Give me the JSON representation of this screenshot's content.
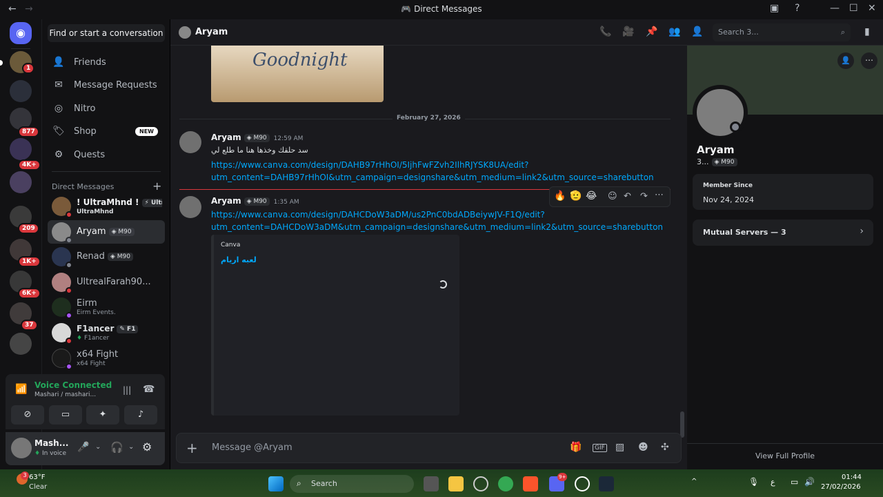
{
  "window": {
    "title": "Direct Messages"
  },
  "guilds": {
    "badges": [
      "1",
      "877",
      "4K+",
      "209",
      "1K+",
      "6K+",
      "37"
    ]
  },
  "dm_sidebar": {
    "find_label": "Find or start a conversation",
    "nav": [
      {
        "label": "Friends",
        "icon": "friends-icon"
      },
      {
        "label": "Message Requests",
        "icon": "envelope-icon"
      },
      {
        "label": "Nitro",
        "icon": "nitro-icon"
      },
      {
        "label": "Shop",
        "icon": "shop-icon",
        "badge": "NEW"
      },
      {
        "label": "Quests",
        "icon": "quests-icon"
      }
    ],
    "section_title": "Direct Messages",
    "dms": [
      {
        "name": "! UltraMhnd !",
        "tag": "Ultr",
        "sub": "UltraMhnd"
      },
      {
        "name": "Aryam",
        "tag": "M90",
        "sub": ""
      },
      {
        "name": "Renad",
        "tag": "M90",
        "sub": ""
      },
      {
        "name": "UltrealFarah90...",
        "tag": "",
        "sub": ""
      },
      {
        "name": "Eirm",
        "tag": "",
        "sub": "Eirm Events."
      },
      {
        "name": "F1ancer",
        "tag": "F1",
        "sub": "F1ancer"
      },
      {
        "name": "x64 Fight",
        "tag": "",
        "sub": "x64 Fight"
      }
    ]
  },
  "voice": {
    "title": "Voice Connected",
    "sub": "Mashari / mashari..."
  },
  "user": {
    "name": "Mash...",
    "status": "In voice"
  },
  "chat": {
    "name": "Aryam",
    "search_placeholder": "Search 3...",
    "date_divider": "February 27, 2026",
    "image_text": "Goodnight",
    "messages": [
      {
        "author": "Aryam",
        "tag": "M90",
        "time": "12:59 AM",
        "text": "سد حلقك وخذها هنا ما طلع لي",
        "link_line1": "https://www.canva.com/design/DAHB97rHhOI/5IjhFwFZvh2IlhRJYSK8UA/edit?",
        "link_line2": "utm_content=DAHB97rHhOI&utm_campaign=designshare&utm_medium=link2&utm_source=sharebutton"
      },
      {
        "author": "Aryam",
        "tag": "M90",
        "time": "1:35 AM",
        "link_line1": "https://www.canva.com/design/DAHCDoW3aDM/us2PnC0bdADBeiywJV-F1Q/edit?",
        "link_line2": "utm_content=DAHCDoW3aDM&utm_campaign=designshare&utm_medium=link2&utm_source=sharebutton",
        "embed_provider": "Canva",
        "embed_title": "لعبه اريام"
      }
    ],
    "reactions": [
      "🔥",
      "🫡",
      "😂"
    ],
    "composer_placeholder": "Message @Aryam"
  },
  "profile": {
    "name": "Aryam",
    "short": "3...",
    "tag": "M90",
    "member_since_label": "Member Since",
    "member_since": "Nov 24, 2024",
    "mutual": "Mutual Servers — 3",
    "view_full": "View Full Profile"
  },
  "taskbar": {
    "temp": "63°F",
    "weather": "Clear",
    "search": "Search",
    "time": "01:44",
    "date": "27/02/2026",
    "lang": "ع",
    "weather_badge": "3",
    "discord_badge": "9+"
  }
}
